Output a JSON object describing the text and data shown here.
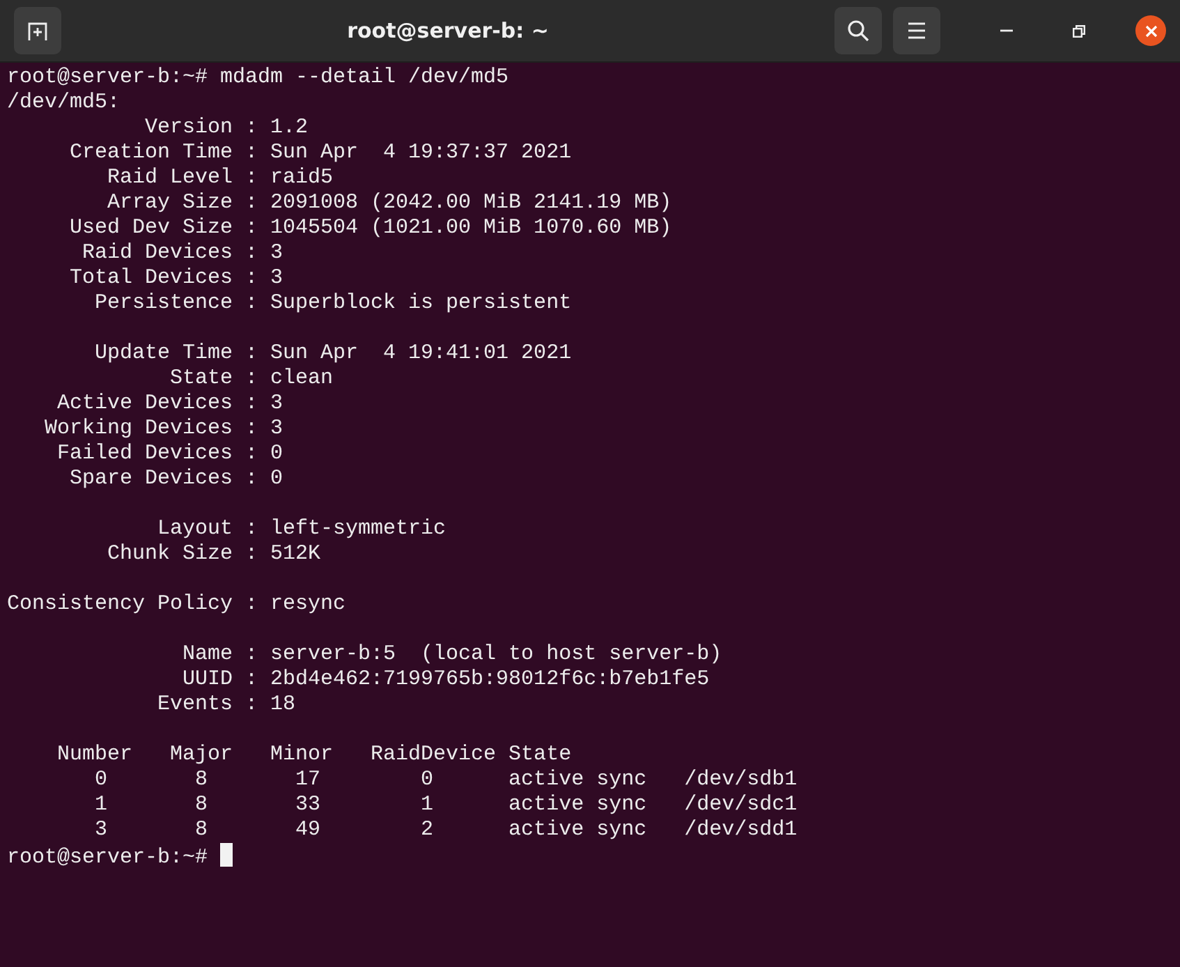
{
  "window": {
    "title": "root@server-b: ~"
  },
  "terminal": {
    "command": {
      "prompt": "root@server-b:~#",
      "text": "mdadm --detail /dev/md5"
    },
    "blocks": [
      [
        "/dev/md5:",
        "           Version : 1.2",
        "     Creation Time : Sun Apr  4 19:37:37 2021",
        "        Raid Level : raid5",
        "        Array Size : 2091008 (2042.00 MiB 2141.19 MB)",
        "     Used Dev Size : 1045504 (1021.00 MiB 1070.60 MB)",
        "      Raid Devices : 3",
        "     Total Devices : 3",
        "       Persistence : Superblock is persistent"
      ],
      [
        "       Update Time : Sun Apr  4 19:41:01 2021",
        "             State : clean",
        "    Active Devices : 3",
        "   Working Devices : 3",
        "    Failed Devices : 0",
        "     Spare Devices : 0"
      ],
      [
        "            Layout : left-symmetric",
        "        Chunk Size : 512K"
      ],
      [
        "Consistency Policy : resync"
      ],
      [
        "              Name : server-b:5  (local to host server-b)",
        "              UUID : 2bd4e462:7199765b:98012f6c:b7eb1fe5",
        "            Events : 18"
      ],
      [
        "    Number   Major   Minor   RaidDevice State",
        "       0       8       17        0      active sync   /dev/sdb1",
        "       1       8       33        1      active sync   /dev/sdc1",
        "       3       8       49        2      active sync   /dev/sdd1"
      ]
    ],
    "final_prompt": {
      "prompt": "root@server-b:~#",
      "cursor": true
    }
  }
}
